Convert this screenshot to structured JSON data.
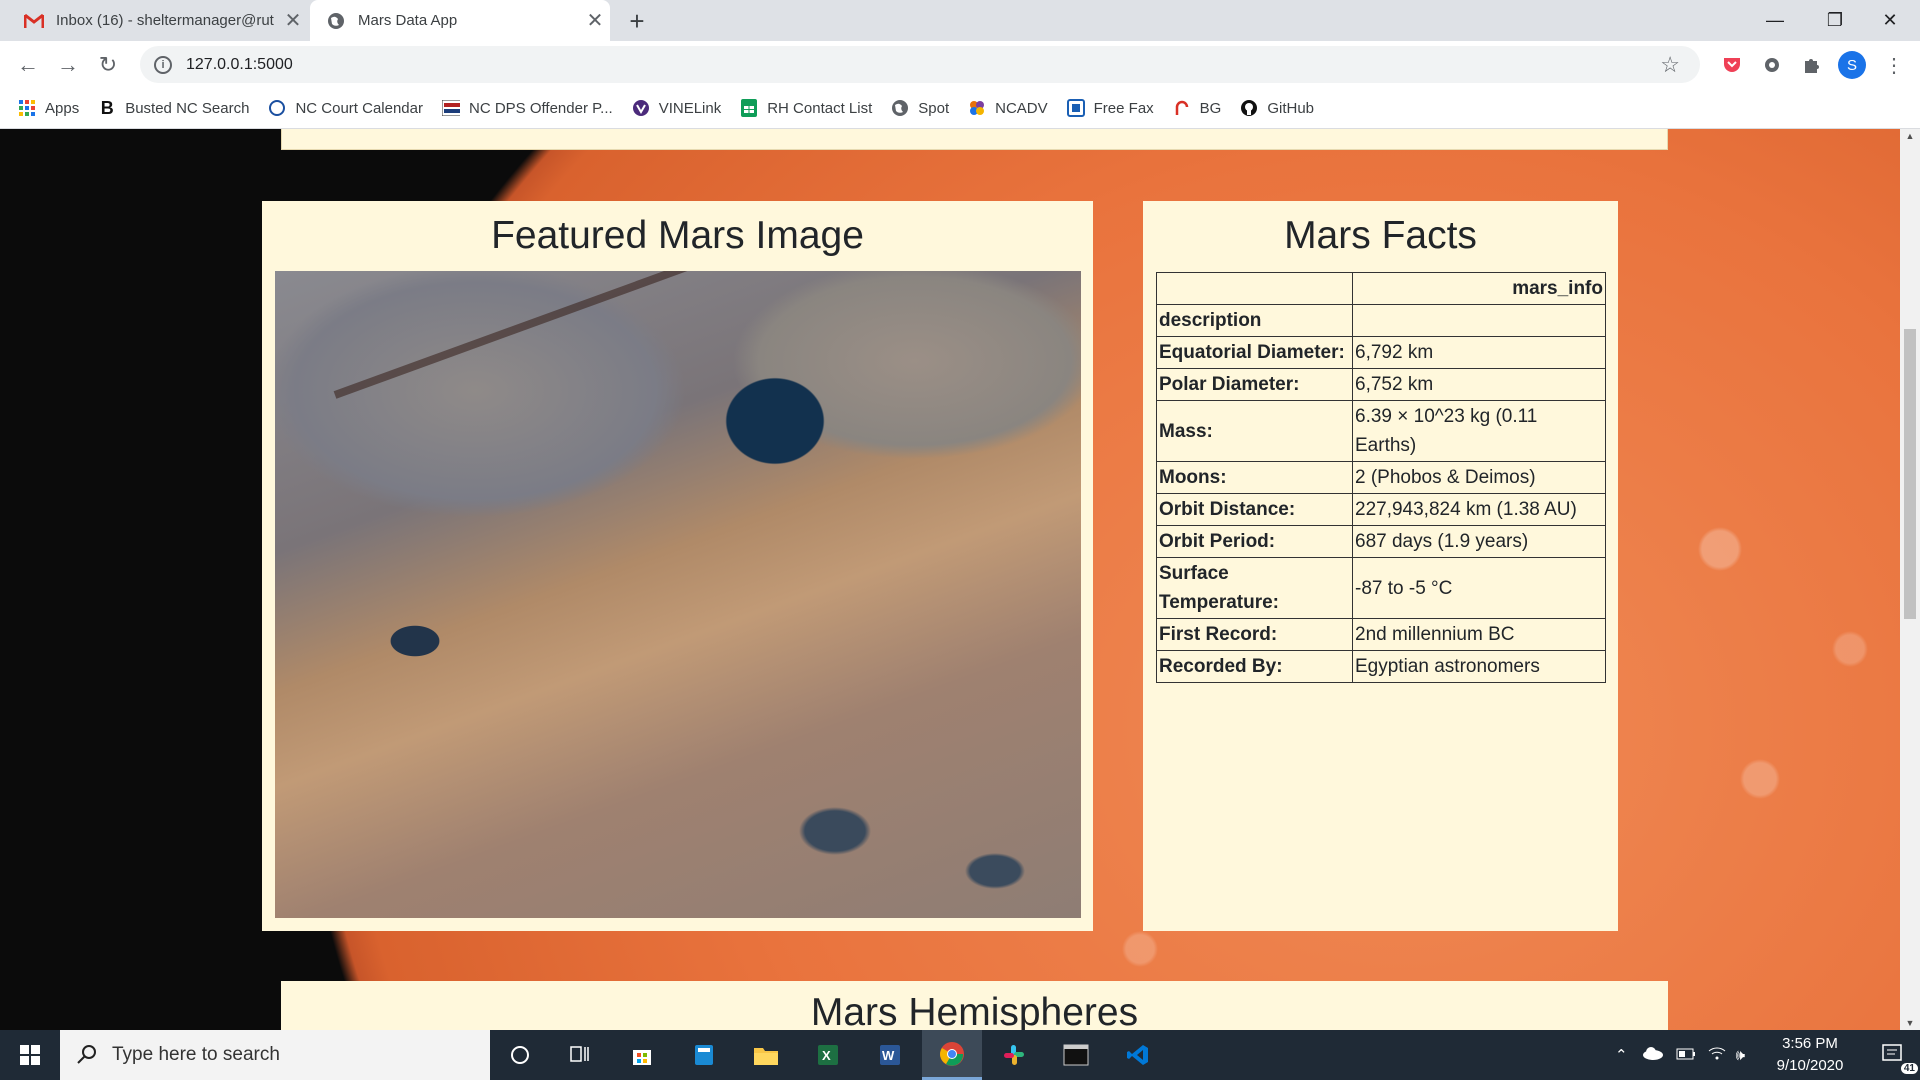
{
  "browser": {
    "tabs": [
      {
        "label": "Inbox (16) - sheltermanager@rut",
        "icon": "gmail-icon"
      },
      {
        "label": "Mars Data App",
        "icon": "globe-icon"
      }
    ],
    "url": "127.0.0.1:5000",
    "profile_initial": "S",
    "bookmarks": [
      {
        "label": "Apps",
        "icon": "apps-grid-icon"
      },
      {
        "label": "Busted NC Search",
        "icon": "b-logo-icon"
      },
      {
        "label": "NC Court Calendar",
        "icon": "circle-icon"
      },
      {
        "label": "NC DPS Offender P...",
        "icon": "dps-icon"
      },
      {
        "label": "VINELink",
        "icon": "vine-icon"
      },
      {
        "label": "RH Contact List",
        "icon": "sheets-icon"
      },
      {
        "label": "Spot",
        "icon": "globe-icon"
      },
      {
        "label": "NCADV",
        "icon": "ncadv-icon"
      },
      {
        "label": "Free Fax",
        "icon": "fax-icon"
      },
      {
        "label": "BG",
        "icon": "bg-icon"
      },
      {
        "label": "GitHub",
        "icon": "github-icon"
      }
    ]
  },
  "page": {
    "featured_title": "Featured Mars Image",
    "facts_title": "Mars Facts",
    "hemispheres_title": "Mars Hemispheres",
    "facts": {
      "header": [
        "",
        "mars_info"
      ],
      "index_label": "description",
      "rows": [
        {
          "key": "Equatorial Diameter:",
          "value": "6,792 km"
        },
        {
          "key": "Polar Diameter:",
          "value": "6,752 km"
        },
        {
          "key": "Mass:",
          "value": "6.39 × 10^23 kg (0.11 Earths)"
        },
        {
          "key": "Moons:",
          "value": "2 (Phobos & Deimos)"
        },
        {
          "key": "Orbit Distance:",
          "value": "227,943,824 km (1.38 AU)"
        },
        {
          "key": "Orbit Period:",
          "value": "687 days (1.9 years)"
        },
        {
          "key": "Surface Temperature:",
          "value": "-87 to -5 °C"
        },
        {
          "key": "First Record:",
          "value": "2nd millennium BC"
        },
        {
          "key": "Recorded By:",
          "value": "Egyptian astronomers"
        }
      ]
    }
  },
  "taskbar": {
    "search_placeholder": "Type here to search",
    "time": "3:56 PM",
    "date": "9/10/2020",
    "notification_count": "41"
  }
}
